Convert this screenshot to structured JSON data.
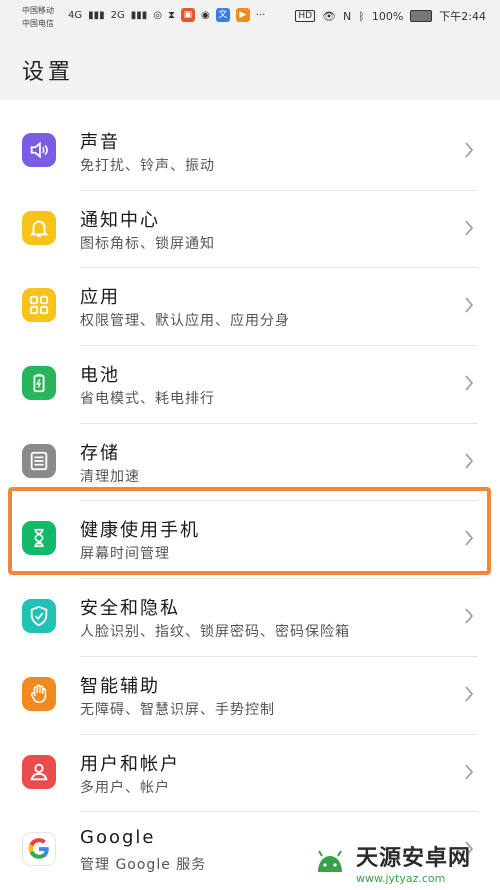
{
  "status_bar": {
    "carrier1": "中国移动",
    "carrier2": "中国电信",
    "net1": "4G",
    "net2": "2G",
    "ellipsis": "···",
    "hd": "HD",
    "battery": "100%",
    "time": "下午2:44"
  },
  "header": {
    "title": "设置"
  },
  "items": [
    {
      "title": "声音",
      "subtitle": "免打扰、铃声、振动",
      "icon": "speaker-icon",
      "color": "#7b5ce6"
    },
    {
      "title": "通知中心",
      "subtitle": "图标角标、锁屏通知",
      "icon": "bell-icon",
      "color": "#f7c21a"
    },
    {
      "title": "应用",
      "subtitle": "权限管理、默认应用、应用分身",
      "icon": "apps-grid-icon",
      "color": "#f7c21a"
    },
    {
      "title": "电池",
      "subtitle": "省电模式、耗电排行",
      "icon": "battery-icon",
      "color": "#27b45a"
    },
    {
      "title": "存储",
      "subtitle": "清理加速",
      "icon": "storage-icon",
      "color": "#8a8a8a"
    },
    {
      "title": "健康使用手机",
      "subtitle": "屏幕时间管理",
      "icon": "hourglass-icon",
      "color": "#14b86a"
    },
    {
      "title": "安全和隐私",
      "subtitle": "人脸识别、指纹、锁屏密码、密码保险箱",
      "icon": "shield-icon",
      "color": "#1fc2b5"
    },
    {
      "title": "智能辅助",
      "subtitle": "无障碍、智慧识屏、手势控制",
      "icon": "hand-icon",
      "color": "#f28b1e"
    },
    {
      "title": "用户和帐户",
      "subtitle": "多用户、帐户",
      "icon": "user-icon",
      "color": "#ea4b4b"
    },
    {
      "title": "Google",
      "subtitle": "管理 Google 服务",
      "icon": "google-icon",
      "color": "#ffffff"
    }
  ],
  "watermark": {
    "name": "天源安卓网",
    "url": "www.jytyaz.com"
  }
}
